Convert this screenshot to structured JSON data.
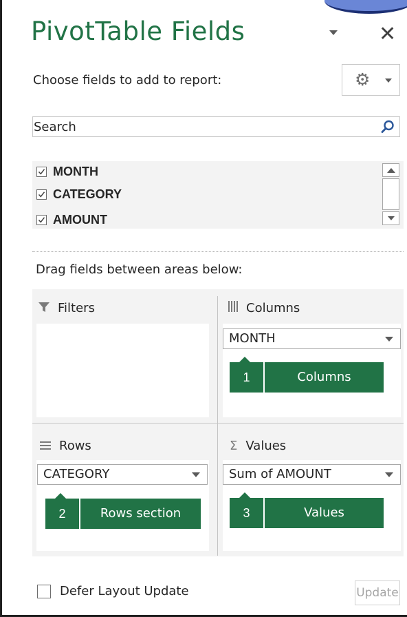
{
  "header": {
    "title": "PivotTable Fields",
    "close_glyph": "✕"
  },
  "tools": {
    "choose_label": "Choose fields to add to report:",
    "gear_icon": "gear-icon"
  },
  "search": {
    "placeholder": "Search",
    "value": ""
  },
  "fields": [
    {
      "label": "MONTH",
      "checked": true
    },
    {
      "label": "CATEGORY",
      "checked": true
    },
    {
      "label": "AMOUNT",
      "checked": true
    }
  ],
  "drag_label": "Drag fields between areas below:",
  "areas": {
    "filters": {
      "title": "Filters"
    },
    "columns": {
      "title": "Columns",
      "field": "MONTH",
      "callout_num": "1",
      "callout_text": "Columns"
    },
    "rows": {
      "title": "Rows",
      "field": "CATEGORY",
      "callout_num": "2",
      "callout_text": "Rows section"
    },
    "values": {
      "title": "Values",
      "field": "Sum of AMOUNT",
      "callout_num": "3",
      "callout_text": "Values",
      "sigma": "Σ"
    }
  },
  "footer": {
    "defer_label": "Defer Layout Update",
    "update_label": "Update"
  },
  "colors": {
    "accent": "#217346",
    "panel_bg": "#f3f3f3"
  }
}
